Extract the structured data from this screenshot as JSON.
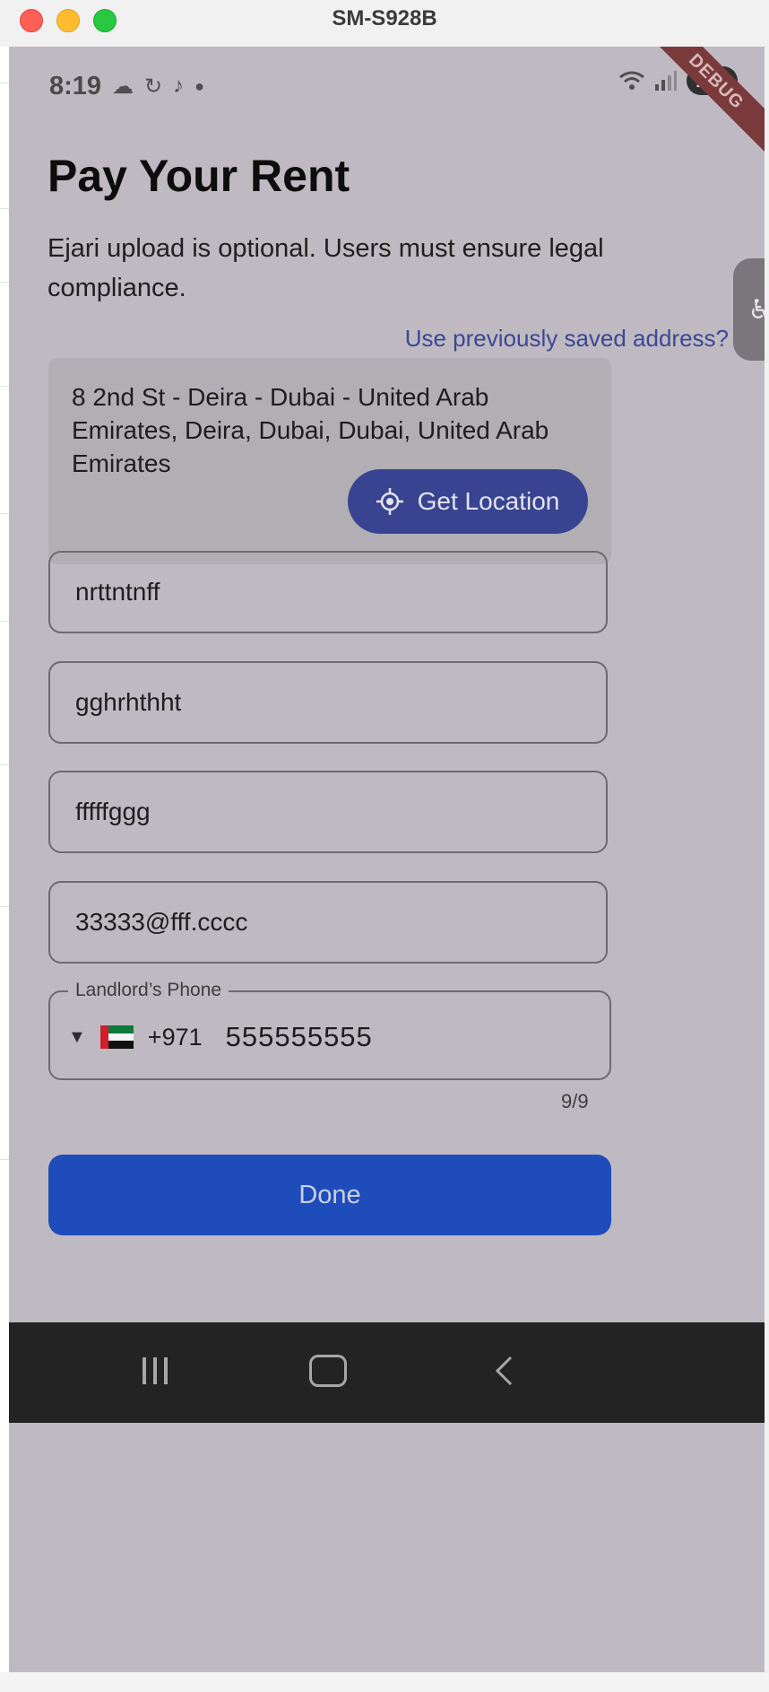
{
  "window": {
    "title": "SM-S928B"
  },
  "status_bar": {
    "time": "8:19",
    "battery": "100",
    "debug_banner": "DEBUG"
  },
  "page": {
    "title": "Pay Your Rent",
    "subtitle": "Ejari upload is optional. Users must ensure legal compliance.",
    "saved_address_link": "Use previously saved address?"
  },
  "address_card": {
    "text": "8 2nd St - Deira - Dubai - United Arab Emirates, Deira, Dubai, Dubai, United Arab Emirates",
    "get_location_label": "Get Location"
  },
  "fields": [
    {
      "value": "nrttntnff"
    },
    {
      "value": "gghrhthht"
    },
    {
      "value": "fffffggg"
    },
    {
      "value": "33333@fff.cccc"
    }
  ],
  "phone": {
    "label": "Landlord’s Phone",
    "country_code": "+971",
    "number": "555555555",
    "counter": "9/9",
    "flag": "uae-flag"
  },
  "done_label": "Done",
  "icons": {
    "status": [
      "cloud-icon",
      "sync-icon",
      "tiktok-icon",
      "dot-icon",
      "wifi-icon",
      "signal-icon"
    ],
    "nav": [
      "recents-icon",
      "home-icon",
      "back-icon"
    ]
  },
  "colors": {
    "screen_bg": "#bfbac1",
    "primary_button": "#1f4cbb",
    "location_button": "#384491",
    "link": "#3b4796"
  }
}
